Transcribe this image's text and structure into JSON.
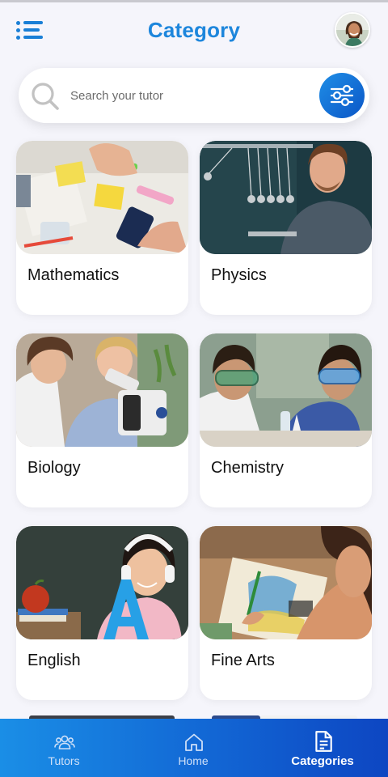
{
  "header": {
    "title": "Category",
    "menu_icon": "menu-list-icon",
    "avatar_icon": "user-avatar"
  },
  "search": {
    "placeholder": "Search your tutor",
    "search_icon": "search-icon",
    "filter_icon": "sliders-icon"
  },
  "categories": [
    {
      "label": "Mathematics",
      "photo": "students with calculator and sticky notes"
    },
    {
      "label": "Physics",
      "photo": "teacher with Newton's cradle"
    },
    {
      "label": "Biology",
      "photo": "students using a microscope"
    },
    {
      "label": "Chemistry",
      "photo": "children with safety goggles"
    },
    {
      "label": "English",
      "photo": "girl with headphones and letter A"
    },
    {
      "label": "Fine Arts",
      "photo": "girl drawing with pencil"
    }
  ],
  "bottom_nav": {
    "items": [
      {
        "label": "Tutors",
        "icon": "users-icon",
        "active": false
      },
      {
        "label": "Home",
        "icon": "home-icon",
        "active": false
      },
      {
        "label": "Categories",
        "icon": "document-icon",
        "active": true
      }
    ]
  },
  "colors": {
    "accent": "#1d86dc",
    "nav_gradient_start": "#1a8ee6",
    "nav_gradient_end": "#0d46c2",
    "background": "#f5f5fb"
  }
}
